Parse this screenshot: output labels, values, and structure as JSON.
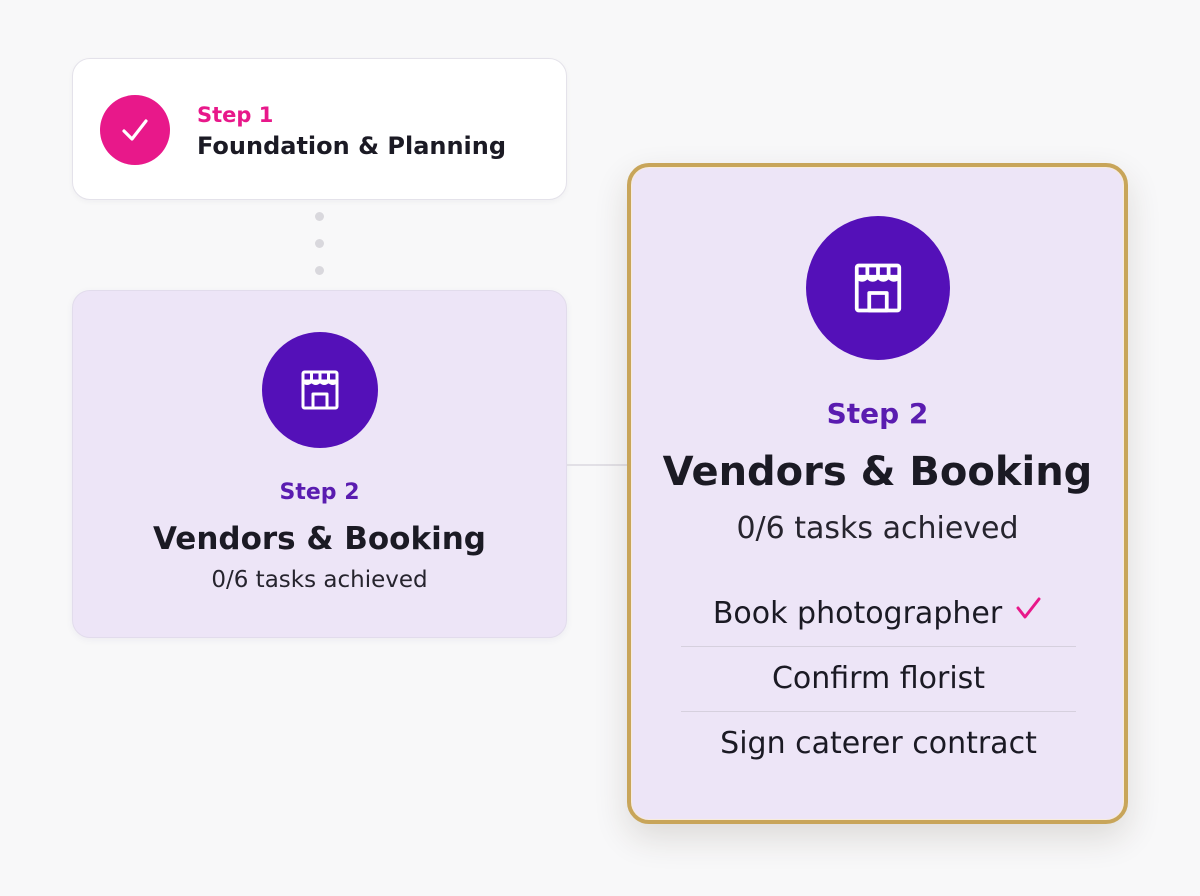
{
  "colors": {
    "accent_pink": "#e8188a",
    "accent_purple": "#5410b8",
    "label_purple": "#5a1cb0",
    "card_lavender": "#ede5f7",
    "gold_border": "#c8a55a"
  },
  "step1": {
    "label": "Step 1",
    "title": "Foundation & Planning",
    "status": "completed",
    "icon": "checkmark-icon"
  },
  "step2": {
    "label": "Step 2",
    "title": "Vendors & Booking",
    "progress": "0/6 tasks achieved",
    "icon": "storefront-icon"
  },
  "detail": {
    "label": "Step 2",
    "title": "Vendors & Booking",
    "progress": "0/6 tasks achieved",
    "icon": "storefront-icon",
    "tasks": [
      {
        "label": "Book photographer",
        "done": true
      },
      {
        "label": "Confirm florist",
        "done": false
      },
      {
        "label": "Sign caterer contract",
        "done": false
      }
    ]
  }
}
